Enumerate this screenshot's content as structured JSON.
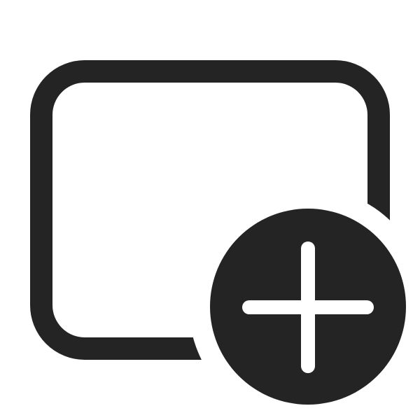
{
  "icon": {
    "name": "add-window-icon",
    "parts": [
      "rounded-rectangle-outline",
      "plus-circle-badge"
    ]
  },
  "colors": {
    "background": "#ffffff",
    "foreground": "#242424"
  }
}
